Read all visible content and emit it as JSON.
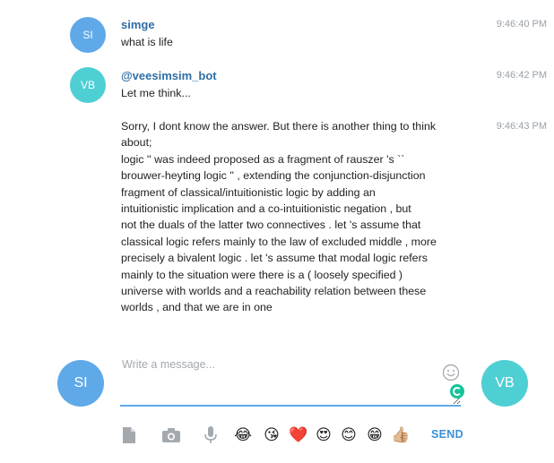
{
  "messages": [
    {
      "avatar": "SI",
      "avatar_color": "#5fa9e9",
      "sender": "simge",
      "time": "9:46:40 PM",
      "lines": [
        "what is life"
      ]
    },
    {
      "avatar": "VB",
      "avatar_color": "#4ecfd4",
      "sender": "@veesimsim_bot",
      "time": "9:46:42 PM",
      "lines": [
        "Let me think..."
      ]
    },
    {
      "time": "9:46:43 PM",
      "lines": [
        "Sorry, I dont know the answer. But there is another thing to think",
        "about;",
        "logic '' was indeed proposed as a fragment of rauszer 's ``",
        "brouwer-heyting logic '' , extending the conjunction-disjunction",
        "fragment of classical/intuitionistic logic by adding an",
        "intuitionistic implication and a co-intuitionistic negation , but",
        "not the duals of the latter two connectives . let 's assume that",
        "classical logic refers mainly to the law of excluded middle , more",
        "precisely a bivalent logic . let 's assume that modal logic refers",
        "mainly to the situation were there is a ( loosely specified )",
        "universe with worlds and a reachability relation between these",
        "worlds , and that we are in one"
      ]
    }
  ],
  "composer": {
    "user_avatar": "SI",
    "bot_avatar": "VB",
    "placeholder": "Write a message...",
    "value": "",
    "send_label": "SEND",
    "emoji_icon": "smile-icon"
  },
  "toolbar": {
    "icons": [
      "document-icon",
      "camera-icon",
      "microphone-icon"
    ],
    "emojis": [
      "😂",
      "😘",
      "❤️",
      "😍",
      "😊",
      "😁",
      "👍🏼"
    ]
  },
  "colors": {
    "accent": "#3a8fd8",
    "name": "#2f6ea5",
    "timestamp": "#9aa1a8",
    "avatar_si": "#5fa9e9",
    "avatar_vb": "#4ecfd4"
  }
}
